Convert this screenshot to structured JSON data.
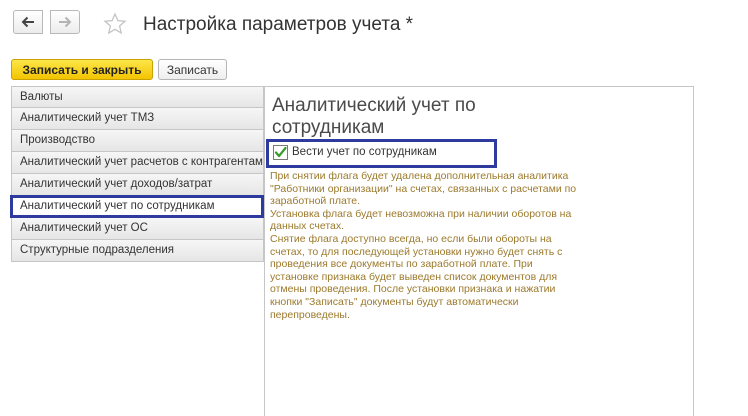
{
  "window": {
    "title": "Настройка параметров учета *"
  },
  "toolbar": {
    "save_close_label": "Записать и закрыть",
    "save_label": "Записать"
  },
  "sidebar": {
    "items": [
      {
        "label": "Валюты"
      },
      {
        "label": "Аналитический учет ТМЗ"
      },
      {
        "label": "Производство"
      },
      {
        "label": "Аналитический учет расчетов с контрагентами"
      },
      {
        "label": "Аналитический учет доходов/затрат"
      },
      {
        "label": "Аналитический учет по сотрудникам"
      },
      {
        "label": "Аналитический учет ОС"
      },
      {
        "label": "Структурные подразделения"
      }
    ],
    "active_index": 5
  },
  "main": {
    "section_title": "Аналитический учет по сотрудникам",
    "checkbox_label": "Вести учет по сотрудникам",
    "checkbox_checked": true,
    "hint_text": "При снятии флага будет удалена дополнительная аналитика \"Работники организации\" на счетах, связанных с расчетами по заработной плате.\nУстановка флага будет невозможна при наличии оборотов на данных счетах.\nСнятие флага доступно всегда, но если были обороты на счетах, то для последующей установки нужно будет снять с проведения все документы по заработной плате. При установке признака будет выведен список документов для отмены проведения. После установки признака и нажатии кнопки \"Записать\" документы будут автоматически перепроведены."
  },
  "colors": {
    "accent_button": "#f5c800",
    "highlight_frame": "#2d3a9e",
    "hint_text": "#9c7a2c",
    "checkmark": "#3a9a2e"
  },
  "icons": {
    "back": "arrow-left-icon",
    "forward": "arrow-right-icon",
    "favorite": "star-icon",
    "check": "checkmark-icon"
  }
}
